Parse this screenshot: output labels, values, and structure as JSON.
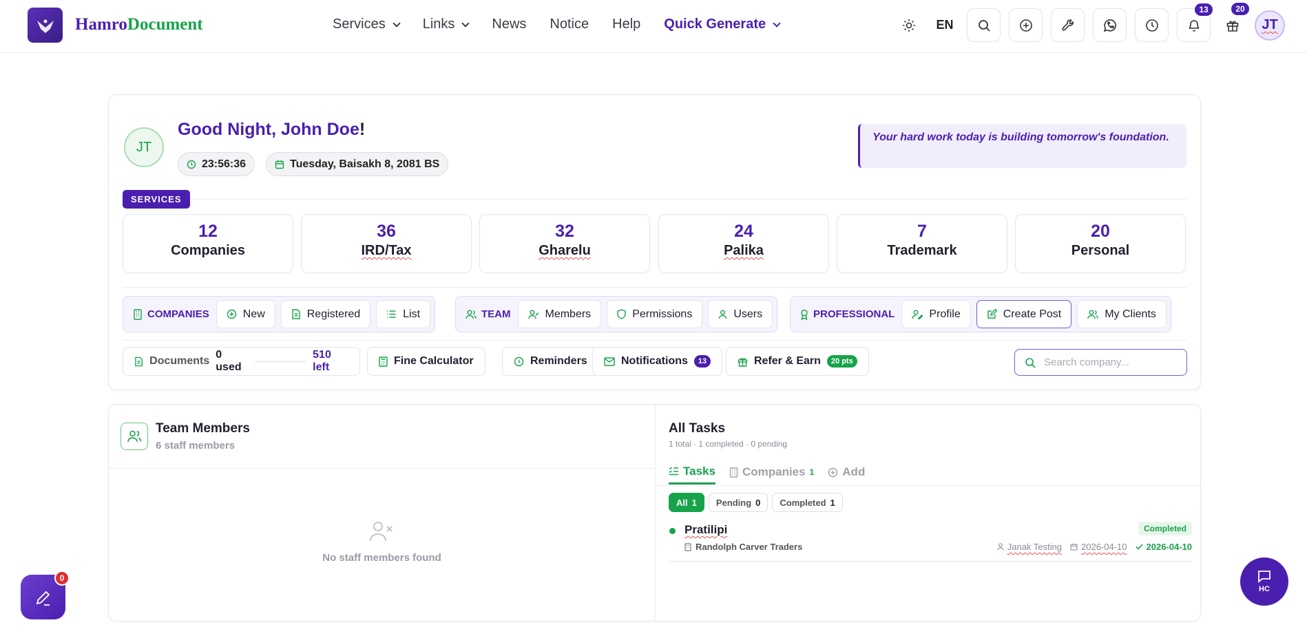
{
  "brand": {
    "part1": "Hamro",
    "part2": "Document"
  },
  "nav": {
    "services": "Services",
    "links": "Links",
    "news": "News",
    "notice": "Notice",
    "help": "Help",
    "quick_generate": "Quick Generate"
  },
  "toolbar": {
    "language": "EN",
    "notifications_count": "13",
    "gifts_count": "20",
    "avatar_initials": "JT"
  },
  "hero": {
    "avatar_initials": "JT",
    "greeting": "Good Night, John Doe",
    "greeting_suffix": "!",
    "time": "23:56:36",
    "date": "Tuesday, Baisakh 8, 2081 BS",
    "quote": "Your hard work today is building tomorrow's foundation."
  },
  "services": {
    "tag": "SERVICES",
    "stats": [
      {
        "count": "12",
        "label": "Companies"
      },
      {
        "count": "36",
        "label": "IRD/Tax"
      },
      {
        "count": "32",
        "label": "Gharelu"
      },
      {
        "count": "24",
        "label": "Palika"
      },
      {
        "count": "7",
        "label": "Trademark"
      },
      {
        "count": "20",
        "label": "Personal"
      }
    ]
  },
  "groups": {
    "companies": {
      "label": "COMPANIES",
      "new": "New",
      "registered": "Registered",
      "list": "List"
    },
    "team": {
      "label": "TEAM",
      "members": "Members",
      "permissions": "Permissions",
      "users": "Users"
    },
    "professional": {
      "label": "PROFESSIONAL",
      "profile": "Profile",
      "create_post": "Create Post",
      "my_clients": "My Clients"
    }
  },
  "tools": {
    "documents_label": "Documents",
    "documents_used": "0 used",
    "documents_left": "510 left",
    "fine_calculator": "Fine Calculator",
    "reminders": "Reminders",
    "notifications": "Notifications",
    "notifications_count": "13",
    "refer_earn": "Refer & Earn",
    "refer_points": "20 pts",
    "search_placeholder": "Search company..."
  },
  "team_members": {
    "title": "Team Members",
    "subtitle": "6 staff members",
    "empty": "No staff members found"
  },
  "tasks": {
    "title": "All Tasks",
    "summary": "1 total · 1 completed · 0 pending",
    "tabs": {
      "tasks": "Tasks",
      "companies": "Companies",
      "companies_count": "1",
      "add": "Add"
    },
    "filters": {
      "all": "All",
      "all_count": "1",
      "pending": "Pending",
      "pending_count": "0",
      "completed": "Completed",
      "completed_count": "1"
    },
    "items": [
      {
        "name": "Pratilipi",
        "company": "Randolph Carver Traders",
        "status": "Completed",
        "assignee": "Janak Testing",
        "due_date": "2026-04-10",
        "completed_date": "2026-04-10"
      }
    ]
  },
  "fab": {
    "draft_count": "0",
    "chat_label": "HC"
  },
  "colors": {
    "primary": "#4a1fb0",
    "success": "#17a34a",
    "danger": "#e02d2d"
  }
}
